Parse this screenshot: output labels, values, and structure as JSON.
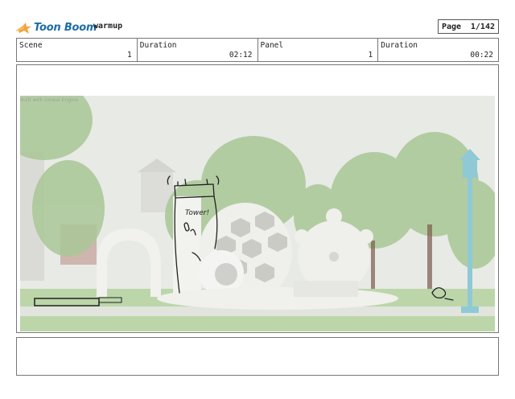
{
  "header": {
    "brand": "Toon Boom",
    "project": "warmup",
    "page_label": "Page",
    "page_value": "1/142"
  },
  "info": {
    "scene_label": "Scene",
    "scene_value": "1",
    "scene_duration_label": "Duration",
    "scene_duration_value": "02:12",
    "panel_label": "Panel",
    "panel_value": "1",
    "panel_duration_label": "Duration",
    "panel_duration_value": "00:22"
  },
  "panel": {
    "watermark": "Built with Unreal Engine",
    "sketch_text": "Tower!"
  },
  "colors": {
    "logo_blue": "#1d6ea6",
    "logo_orange": "#f2a23a",
    "foliage": "#8fb877",
    "lamp": "#8fc9d6"
  }
}
